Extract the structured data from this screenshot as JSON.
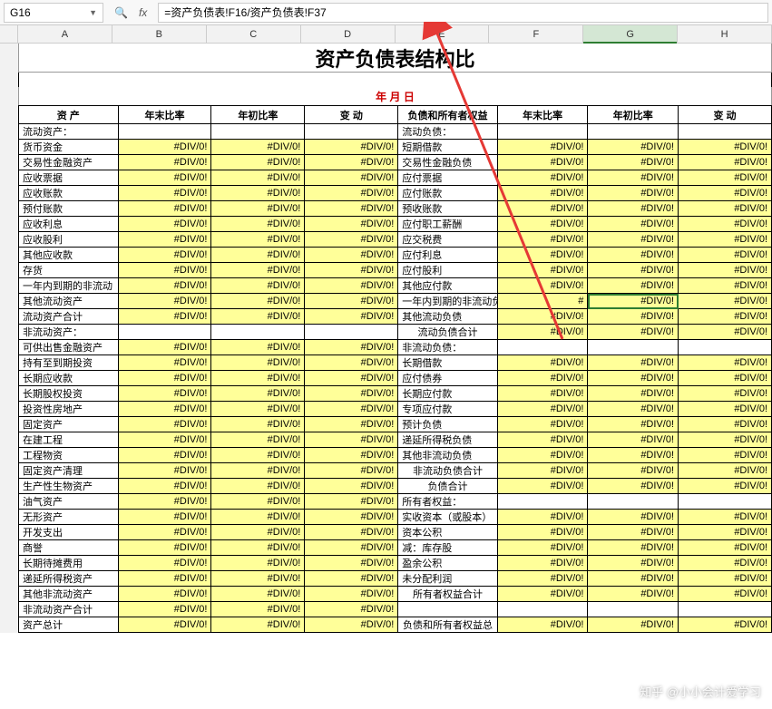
{
  "cell_ref": "G16",
  "formula": "=资产负债表!F16/资产负债表!F37",
  "columns": [
    "A",
    "B",
    "C",
    "D",
    "E",
    "F",
    "G",
    "H"
  ],
  "active_col": "G",
  "title": "资产负债表结构比",
  "date_label": "年  月  日",
  "headers": {
    "c1": "资  产",
    "c2": "年末比率",
    "c3": "年初比率",
    "c4": "变  动",
    "c5": "负债和所有者权益",
    "c6": "年末比率",
    "c7": "年初比率",
    "c8": "变  动"
  },
  "err": "#DIV/0!",
  "rows": [
    {
      "l": "流动资产：",
      "lv": false,
      "r": "流动负债：",
      "rv": false
    },
    {
      "l": "货币资金",
      "lv": true,
      "r": "短期借款",
      "rv": true
    },
    {
      "l": "交易性金融资产",
      "lv": true,
      "r": "交易性金融负债",
      "rv": true
    },
    {
      "l": "应收票据",
      "lv": true,
      "r": "应付票据",
      "rv": true
    },
    {
      "l": "应收账款",
      "lv": true,
      "r": "应付账款",
      "rv": true
    },
    {
      "l": "预付账款",
      "lv": true,
      "r": "预收账款",
      "rv": true
    },
    {
      "l": "应收利息",
      "lv": true,
      "r": "应付职工薪酬",
      "rv": true
    },
    {
      "l": "应收股利",
      "lv": true,
      "r": "应交税费",
      "rv": true
    },
    {
      "l": "其他应收款",
      "lv": true,
      "r": "应付利息",
      "rv": true
    },
    {
      "l": "存货",
      "lv": true,
      "r": "应付股利",
      "rv": true
    },
    {
      "l": "一年内到期的非流动",
      "lv": true,
      "r": "其他应付款",
      "rv": true
    },
    {
      "l": "其他流动资产",
      "lv": true,
      "r": "一年内到期的非流动负",
      "rv": true,
      "sel": true,
      "hash": true
    },
    {
      "l": "    流动资产合计",
      "lv": true,
      "r": "其他流动负债",
      "rv": true
    },
    {
      "l": "非流动资产：",
      "lv": false,
      "r": "          流动负债合计",
      "rv": true,
      "rcenter": true
    },
    {
      "l": "可供出售金融资产",
      "lv": true,
      "r": "非流动负债：",
      "rv": false
    },
    {
      "l": "持有至到期投资",
      "lv": true,
      "r": "长期借款",
      "rv": true
    },
    {
      "l": "长期应收款",
      "lv": true,
      "r": "应付债券",
      "rv": true
    },
    {
      "l": "长期股权投资",
      "lv": true,
      "r": "长期应付款",
      "rv": true
    },
    {
      "l": "投资性房地产",
      "lv": true,
      "r": "专项应付款",
      "rv": true
    },
    {
      "l": "固定资产",
      "lv": true,
      "r": "预计负债",
      "rv": true
    },
    {
      "l": "在建工程",
      "lv": true,
      "r": "递延所得税负债",
      "rv": true
    },
    {
      "l": "工程物资",
      "lv": true,
      "r": "其他非流动负债",
      "rv": true
    },
    {
      "l": "固定资产清理",
      "lv": true,
      "r": "        非流动负债合计",
      "rv": true,
      "rcenter": true
    },
    {
      "l": "生产性生物资产",
      "lv": true,
      "r": "            负债合计",
      "rv": true,
      "rcenter": true
    },
    {
      "l": "油气资产",
      "lv": true,
      "r": "所有者权益：",
      "rv": false
    },
    {
      "l": "无形资产",
      "lv": true,
      "r": "实收资本（或股本）",
      "rv": true
    },
    {
      "l": "开发支出",
      "lv": true,
      "r": "资本公积",
      "rv": true
    },
    {
      "l": "商誉",
      "lv": true,
      "r": "减：库存股",
      "rv": true
    },
    {
      "l": "长期待摊费用",
      "lv": true,
      "r": "盈余公积",
      "rv": true
    },
    {
      "l": "递延所得税资产",
      "lv": true,
      "r": "未分配利润",
      "rv": true
    },
    {
      "l": "其他非流动资产",
      "lv": true,
      "r": "      所有者权益合计",
      "rv": true,
      "rcenter": true
    },
    {
      "l": "    非流动资产合计",
      "lv": true,
      "r": "",
      "rv": false
    },
    {
      "l": "        资产总计",
      "lv": true,
      "r": "  负债和所有者权益总",
      "rv": true,
      "rcenter": true
    }
  ],
  "watermark": "知乎 @小小会计爱学习"
}
